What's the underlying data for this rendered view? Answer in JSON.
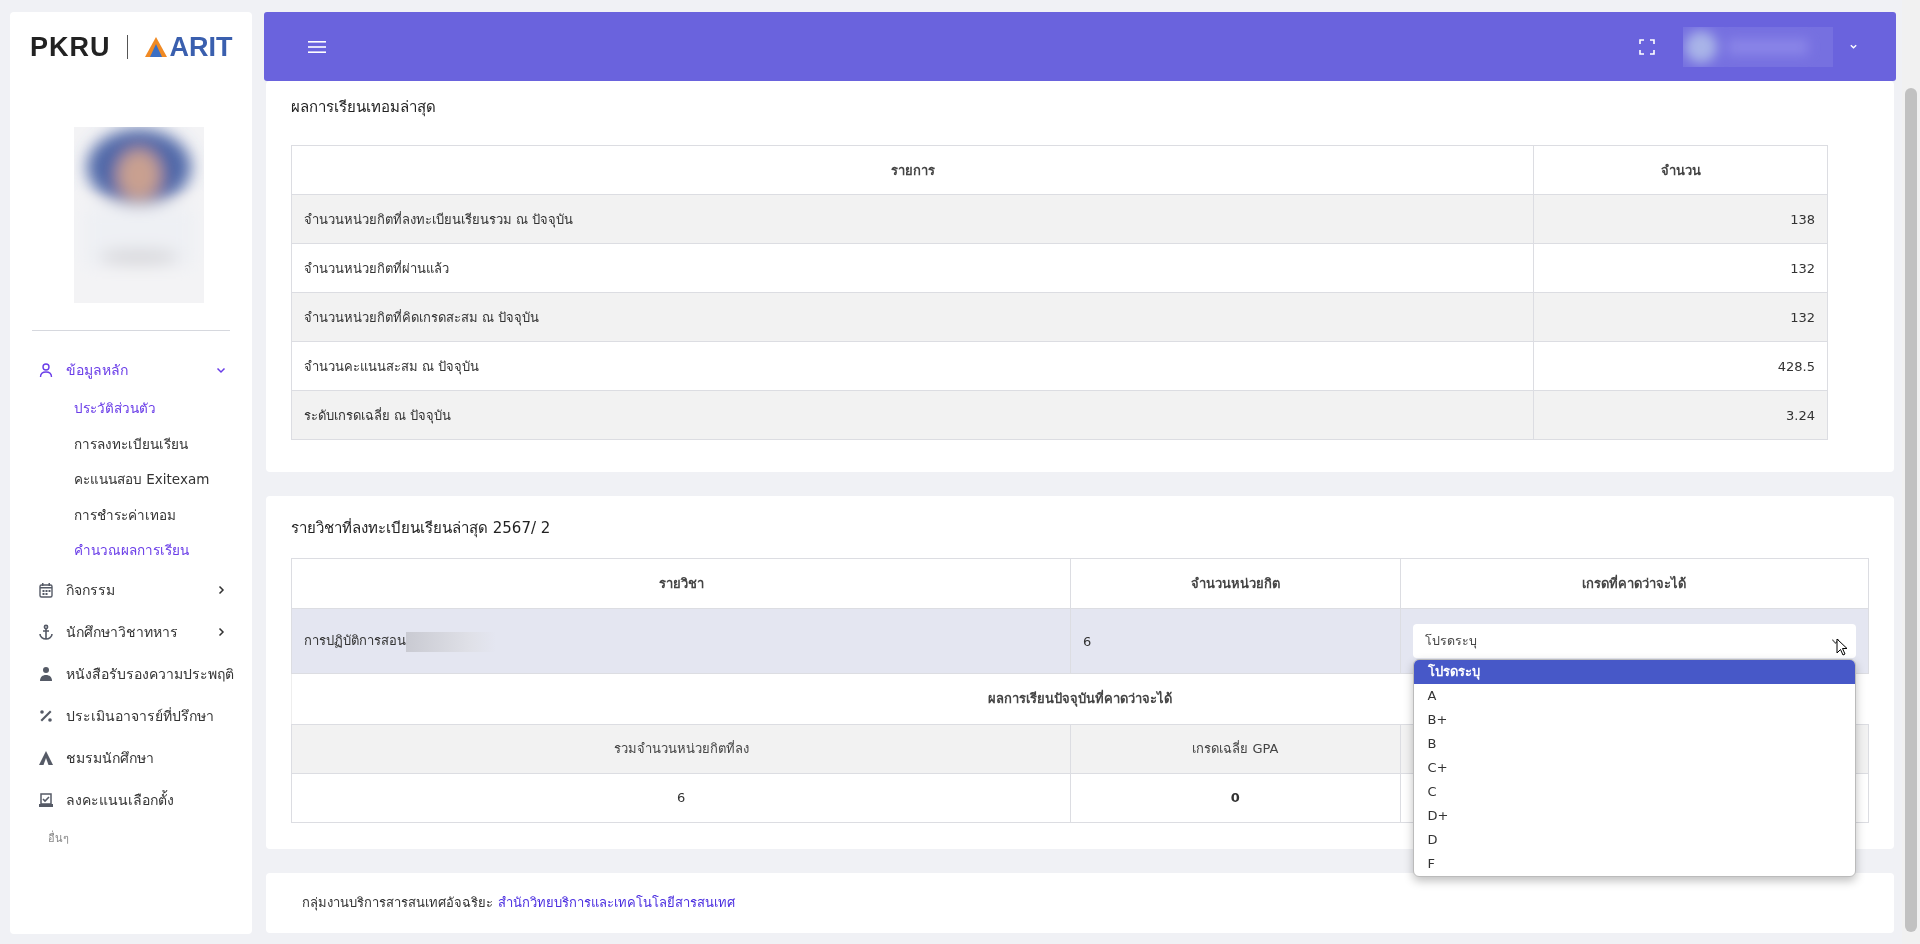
{
  "sidebar": {
    "logo": {
      "left": "PKRU",
      "right": "ARIT"
    },
    "menu": [
      {
        "label": "ข้อมูลหลัก",
        "selected": true,
        "expanded": true,
        "children": [
          {
            "label": "ประวัติส่วนตัว",
            "selected": true
          },
          {
            "label": "การลงทะเบียนเรียน",
            "selected": false
          },
          {
            "label": "คะแนนสอบ Exitexam",
            "selected": false
          },
          {
            "label": "การชำระค่าเทอม",
            "selected": false
          },
          {
            "label": "คำนวณผลการเรียน",
            "selected": true
          }
        ]
      },
      {
        "label": "กิจกรรม",
        "selected": false,
        "expanded": false
      },
      {
        "label": "นักศึกษาวิชาทหาร",
        "selected": false,
        "expanded": false
      },
      {
        "label": "หนังสือรับรองความประพฤติ",
        "selected": false
      },
      {
        "label": "ประเมินอาจารย์ที่ปรึกษา",
        "selected": false
      },
      {
        "label": "ชมรมนักศึกษา",
        "selected": false
      },
      {
        "label": "ลงคะแนนเลือกตั้ง",
        "selected": false
      }
    ],
    "section_label": "อื่นๆ"
  },
  "latest_results": {
    "title": "ผลการเรียนเทอมล่าสุด",
    "columns": [
      "รายการ",
      "จำนวน"
    ],
    "rows": [
      {
        "item": "จำนวนหน่วยกิตที่ลงทะเบียนเรียนรวม ณ ปัจจุบัน",
        "value": "138"
      },
      {
        "item": "จำนวนหน่วยกิตที่ผ่านแล้ว",
        "value": "132"
      },
      {
        "item": "จำนวนหน่วยกิตที่คิดเกรดสะสม ณ ปัจจุบัน",
        "value": "132"
      },
      {
        "item": "จำนวนคะแนนสะสม ณ ปัจจุบัน",
        "value": "428.5"
      },
      {
        "item": "ระดับเกรดเฉลี่ย ณ ปัจจุบัน",
        "value": "3.24"
      }
    ]
  },
  "registered_courses": {
    "title": "รายวิชาที่ลงทะเบียนเรียนล่าสุด 2567/ 2",
    "columns": [
      "รายวิชา",
      "จำนวนหน่วยกิต",
      "เกรดที่คาดว่าจะได้"
    ],
    "rows": [
      {
        "course": "การปฏิบัติการสอน",
        "credits": "6",
        "grade_select": {
          "value": "โปรดระบุ",
          "open": true,
          "options": [
            {
              "label": "โปรดระบุ",
              "selected": true
            },
            {
              "label": "A",
              "selected": false
            },
            {
              "label": "B+",
              "selected": false
            },
            {
              "label": "B",
              "selected": false
            },
            {
              "label": "C+",
              "selected": false
            },
            {
              "label": "C",
              "selected": false
            },
            {
              "label": "D+",
              "selected": false
            },
            {
              "label": "D",
              "selected": false
            },
            {
              "label": "F",
              "selected": false
            }
          ]
        }
      }
    ],
    "summary": {
      "title": "ผลการเรียนปัจจุบันที่คาดว่าจะได้",
      "columns": [
        "รวมจำนวนหน่วยกิตที่ลง",
        "เกรดเฉลี่ย GPA"
      ],
      "values": [
        "6",
        "0"
      ]
    }
  },
  "footer": {
    "text": "กลุ่มงานบริการสารสนเทศอัจฉริยะ",
    "link": "สำนักวิทยบริการและเทคโนโลยีสารสนเทศ"
  }
}
